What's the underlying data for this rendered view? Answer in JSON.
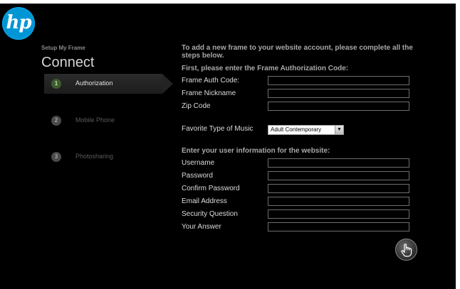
{
  "brand": {
    "logo_text": "hp",
    "logo_color": "#0096d6"
  },
  "sidebar": {
    "setup_label": "Setup My Frame",
    "title": "Connect",
    "steps": [
      {
        "number": "1",
        "label": "Authorization",
        "active": true
      },
      {
        "number": "2",
        "label": "Mobile Phone",
        "active": false
      },
      {
        "number": "3",
        "label": "Photosharing",
        "active": false
      }
    ]
  },
  "form": {
    "intro": "To add a new frame to your website account, please complete all the steps below.",
    "auth_heading": "First, please enter the Frame Authorization Code:",
    "frame_fields": [
      {
        "label": "Frame Auth Code:",
        "value": ""
      },
      {
        "label": "Frame Nickname",
        "value": ""
      },
      {
        "label": "Zip Code",
        "value": ""
      }
    ],
    "music": {
      "label": "Favorite Type of Music",
      "selected": "Adult Contemporary",
      "arrow_icon": "chevron-down-icon"
    },
    "user_heading": "Enter your user information for the website:",
    "user_fields": [
      {
        "label": "Username",
        "value": ""
      },
      {
        "label": "Password",
        "value": ""
      },
      {
        "label": "Confirm Password",
        "value": ""
      },
      {
        "label": "Email Address",
        "value": ""
      },
      {
        "label": "Security Question",
        "value": ""
      },
      {
        "label": "Your Answer",
        "value": ""
      }
    ],
    "submit_icon": "hand-pointer-icon"
  }
}
